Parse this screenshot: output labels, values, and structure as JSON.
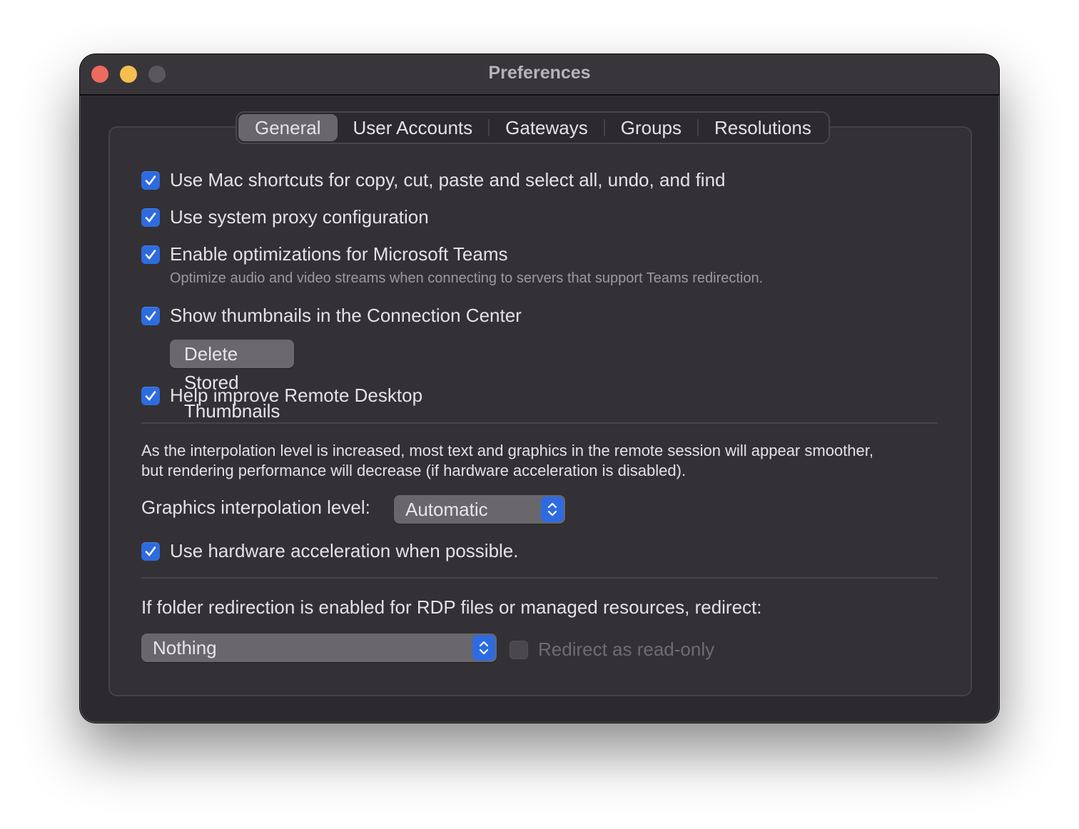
{
  "window": {
    "title": "Preferences"
  },
  "tabs": [
    {
      "label": "General",
      "active": true
    },
    {
      "label": "User Accounts",
      "active": false
    },
    {
      "label": "Gateways",
      "active": false
    },
    {
      "label": "Groups",
      "active": false
    },
    {
      "label": "Resolutions",
      "active": false
    }
  ],
  "options": {
    "mac_shortcuts": {
      "label": "Use Mac shortcuts for copy, cut, paste and select all, undo, and find",
      "checked": true
    },
    "system_proxy": {
      "label": "Use system proxy configuration",
      "checked": true
    },
    "teams_optimizations": {
      "label": "Enable optimizations for Microsoft Teams",
      "checked": true,
      "description": "Optimize audio and video streams when connecting to servers that support Teams redirection."
    },
    "show_thumbnails": {
      "label": "Show thumbnails in the Connection Center",
      "checked": true
    },
    "delete_thumbnails_button": "Delete Stored Thumbnails",
    "help_improve": {
      "label": "Help improve Remote Desktop",
      "checked": true
    }
  },
  "graphics": {
    "description_line1": "As the interpolation level is increased, most text and graphics in the remote session will appear smoother,",
    "description_line2": "but rendering performance will decrease (if hardware acceleration is disabled).",
    "interpolation_label": "Graphics interpolation level:",
    "interpolation_value": "Automatic",
    "hardware_acceleration": {
      "label": "Use hardware acceleration when possible.",
      "checked": true
    }
  },
  "folder_redirection": {
    "label": "If folder redirection is enabled for RDP files or managed resources, redirect:",
    "value": "Nothing",
    "read_only": {
      "label": "Redirect as read-only",
      "checked": false,
      "disabled": true
    }
  },
  "colors": {
    "accent": "#2e6bde",
    "window_bg": "#2c2a2e",
    "close": "#ec6a5e",
    "minimize": "#f4bf4f"
  }
}
